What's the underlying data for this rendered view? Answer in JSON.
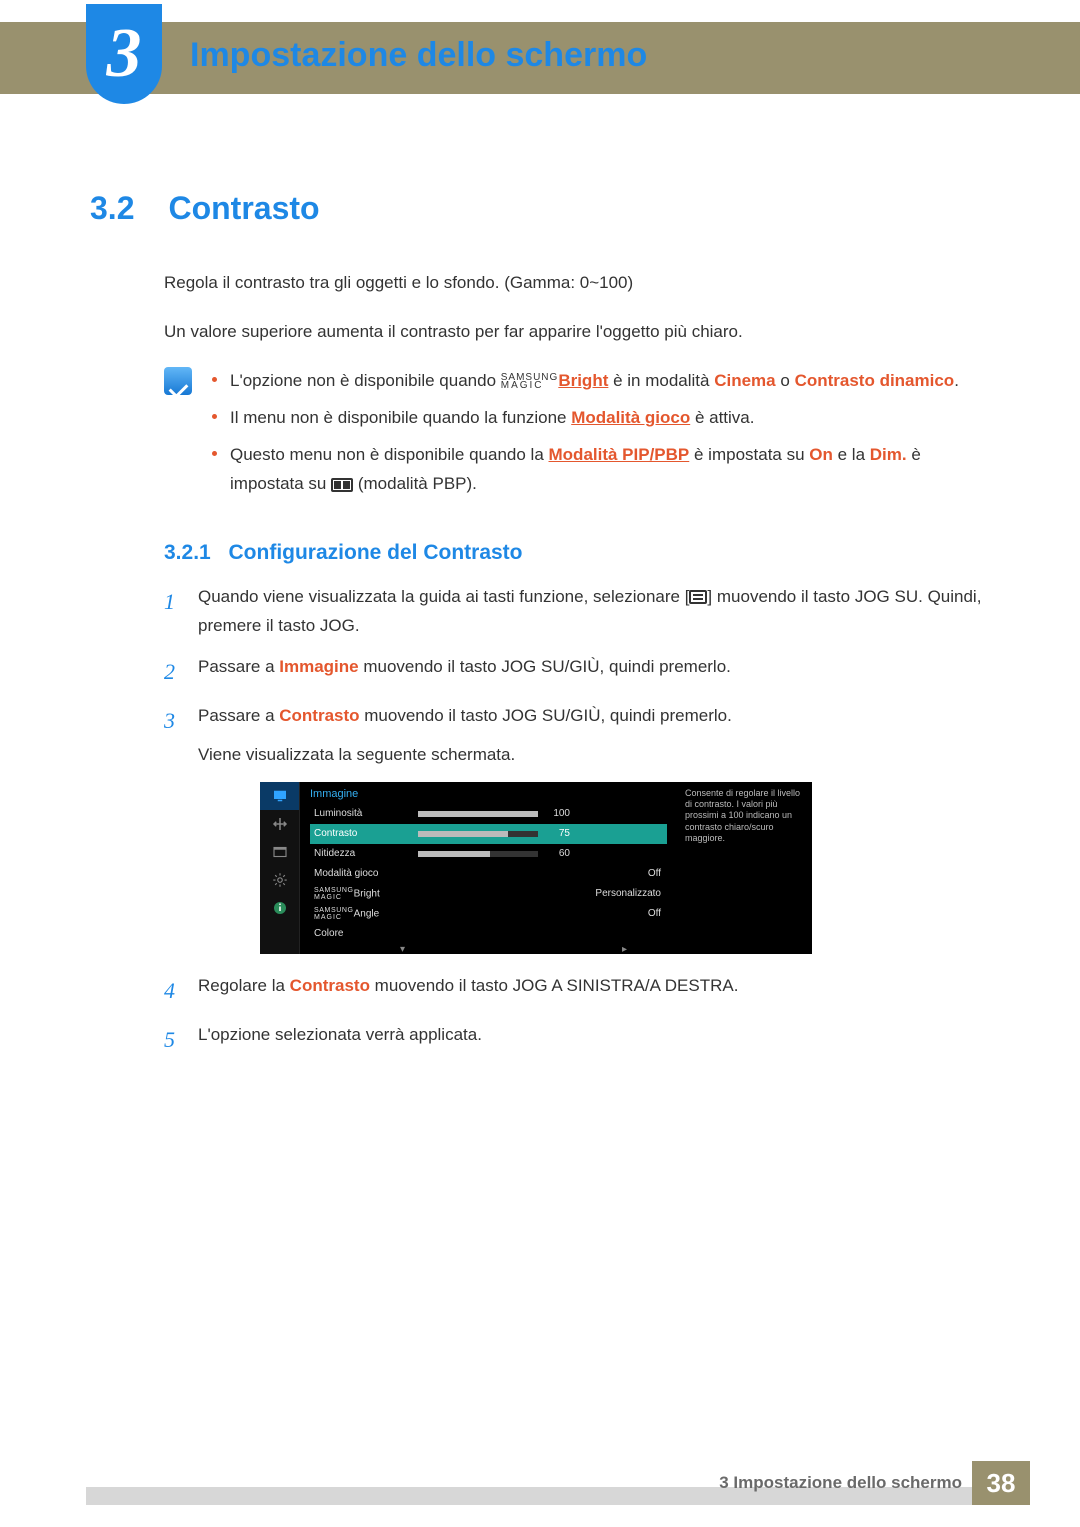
{
  "chapter": {
    "number": "3",
    "title": "Impostazione dello schermo"
  },
  "section": {
    "number": "3.2",
    "title": "Contrasto"
  },
  "intro": {
    "p1": "Regola il contrasto tra gli oggetti e lo sfondo. (Gamma: 0~100)",
    "p2": "Un valore superiore aumenta il contrasto per far apparire l'oggetto più chiaro."
  },
  "notes": {
    "n1_a": "L'opzione non è disponibile quando ",
    "n1_magic_link": "Bright",
    "n1_b": " è in modalità ",
    "n1_cinema": "Cinema",
    "n1_c": " o ",
    "n1_dyncon": "Contrasto dinamico",
    "n1_d": ".",
    "n2_a": "Il menu non è disponibile quando la funzione ",
    "n2_link": "Modalità gioco",
    "n2_b": " è attiva.",
    "n3_a": "Questo menu non è disponibile quando la ",
    "n3_link": "Modalità PIP/PBP",
    "n3_b": " è impostata su ",
    "n3_on": "On",
    "n3_c": " e la ",
    "n3_dim": "Dim.",
    "n3_d": " è impostata su ",
    "n3_e": " (modalità PBP)."
  },
  "subsection": {
    "number": "3.2.1",
    "title": "Configurazione del Contrasto"
  },
  "steps": {
    "s1a": "Quando viene visualizzata la guida ai tasti funzione, selezionare [",
    "s1b": "] muovendo il tasto JOG SU. Quindi, premere il tasto JOG.",
    "s2a": "Passare a ",
    "s2_immagine": "Immagine",
    "s2b": " muovendo il tasto JOG SU/GIÙ, quindi premerlo.",
    "s3a": "Passare a ",
    "s3_contrasto": "Contrasto",
    "s3b": " muovendo il tasto JOG SU/GIÙ, quindi premerlo.",
    "s3c": "Viene visualizzata la seguente schermata.",
    "s4a": "Regolare la ",
    "s4_contrasto": "Contrasto",
    "s4b": " muovendo il tasto JOG A SINISTRA/A DESTRA.",
    "s5": "L'opzione selezionata verrà applicata."
  },
  "osd": {
    "header": "Immagine",
    "rows": [
      {
        "label": "Luminosità",
        "value": "100",
        "fill": 100
      },
      {
        "label": "Contrasto",
        "value": "75",
        "fill": 75,
        "selected": true
      },
      {
        "label": "Nitidezza",
        "value": "60",
        "fill": 60
      },
      {
        "label": "Modalità gioco",
        "right": "Off"
      },
      {
        "label": "MAGICBright",
        "right": "Personalizzato",
        "magic": true
      },
      {
        "label": "MAGICAngle",
        "right": "Off",
        "magic": true
      },
      {
        "label": "Colore",
        "right": ""
      }
    ],
    "desc": "Consente di regolare il livello di contrasto. I valori più prossimi a 100 indicano un contrasto chiaro/scuro maggiore."
  },
  "magic_label": {
    "top": "SAMSUNG",
    "bottom": "MAGIC"
  },
  "footer": {
    "text": "3 Impostazione dello schermo",
    "page": "38"
  }
}
